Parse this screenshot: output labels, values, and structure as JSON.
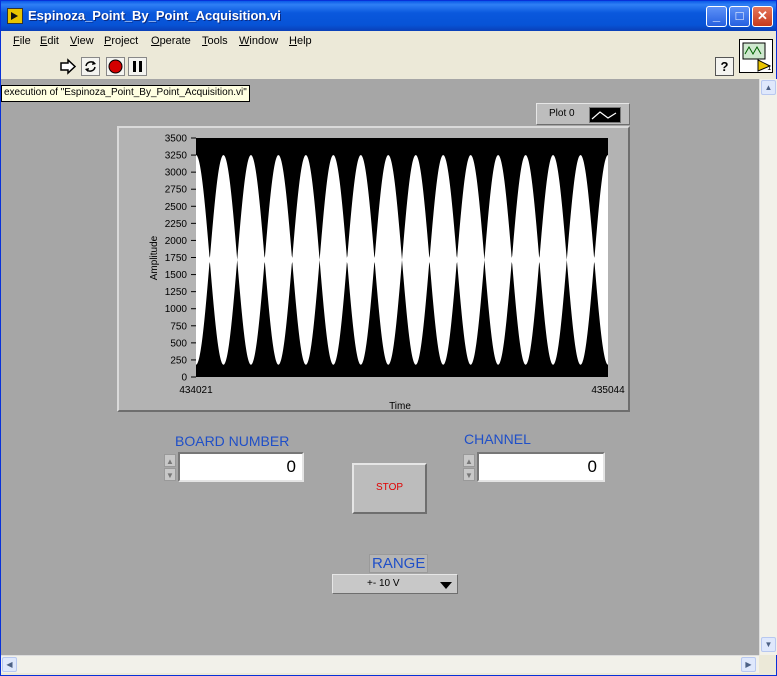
{
  "window": {
    "title": "Espinoza_Point_By_Point_Acquisition.vi",
    "minimize": "_",
    "maximize": "□",
    "close": "✕"
  },
  "menu": [
    "File",
    "Edit",
    "View",
    "Project",
    "Operate",
    "Tools",
    "Window",
    "Help"
  ],
  "toolbar": {
    "help": "?",
    "icons": [
      "run-arrow-icon",
      "run-continuously-icon",
      "abort-execution-icon",
      "pause-icon"
    ]
  },
  "tooltip": "execution of \"Espinoza_Point_By_Point_Acquisition.vi\"",
  "graph": {
    "legend_label": "Plot 0",
    "ylabel": "Amplitude",
    "xlabel": "Time",
    "yticks": [
      "3500",
      "3250",
      "3000",
      "2750",
      "2500",
      "2250",
      "2000",
      "1750",
      "1500",
      "1250",
      "1000",
      "750",
      "500",
      "250",
      "0"
    ],
    "xticks": [
      "434021",
      "435044"
    ]
  },
  "chart_data": {
    "type": "line",
    "title": "",
    "xlabel": "Time",
    "ylabel": "Amplitude",
    "xlim": [
      434021,
      435044
    ],
    "ylim": [
      0,
      3500
    ],
    "grid": false,
    "legend": "top-right",
    "series": [
      {
        "name": "Plot 0",
        "color": "#ffffff",
        "envelope_cycles": 15,
        "upper_peak": 3250,
        "lower_peak": 180
      }
    ],
    "background": "#000000"
  },
  "controls": {
    "board_label": "BOARD NUMBER",
    "board_value": "0",
    "channel_label": "CHANNEL",
    "channel_value": "0",
    "stop_label": "STOP",
    "range_label": "RANGE",
    "range_value": "+- 10 V"
  },
  "colors": {
    "label_blue": "#1f4fc8",
    "stop_text": "#e00000",
    "panel_gray": "#a6a6a6"
  }
}
